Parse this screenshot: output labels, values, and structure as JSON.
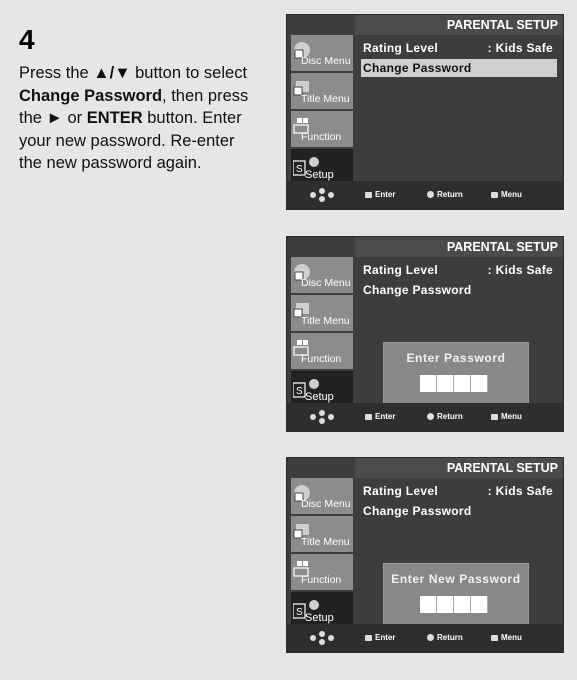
{
  "step": {
    "number": "4",
    "instructions_parts": {
      "p1": "Press the ",
      "arrows": "▲/▼",
      "p2": " button to select ",
      "b1": "Change Password",
      "p3": ", then press the ",
      "play": "►",
      "p4": " or ",
      "b2": "ENTER",
      "p5": " button.",
      "p6": "Enter your new password. Re-enter the new password again."
    }
  },
  "sidebar_items": [
    "Disc Menu",
    "Title Menu",
    "Function",
    "Setup"
  ],
  "screens": [
    {
      "title": "PARENTAL SETUP",
      "rows": [
        {
          "label": "Rating Level",
          "value": ": Kids Safe"
        },
        {
          "label": "Change Password",
          "value": ""
        }
      ],
      "selected_row": 1,
      "dialog": null
    },
    {
      "title": "PARENTAL SETUP",
      "rows": [
        {
          "label": "Rating Level",
          "value": ": Kids Safe"
        },
        {
          "label": "Change Password",
          "value": ""
        }
      ],
      "selected_row": -1,
      "dialog": {
        "title": "Enter Password",
        "digits": 4
      }
    },
    {
      "title": "PARENTAL SETUP",
      "rows": [
        {
          "label": "Rating Level",
          "value": ": Kids Safe"
        },
        {
          "label": "Change Password",
          "value": ""
        }
      ],
      "selected_row": -1,
      "dialog": {
        "title": "Enter New Password",
        "digits": 4
      }
    }
  ],
  "bottom_bar": {
    "enter": "Enter",
    "return": "Return",
    "menu": "Menu"
  }
}
